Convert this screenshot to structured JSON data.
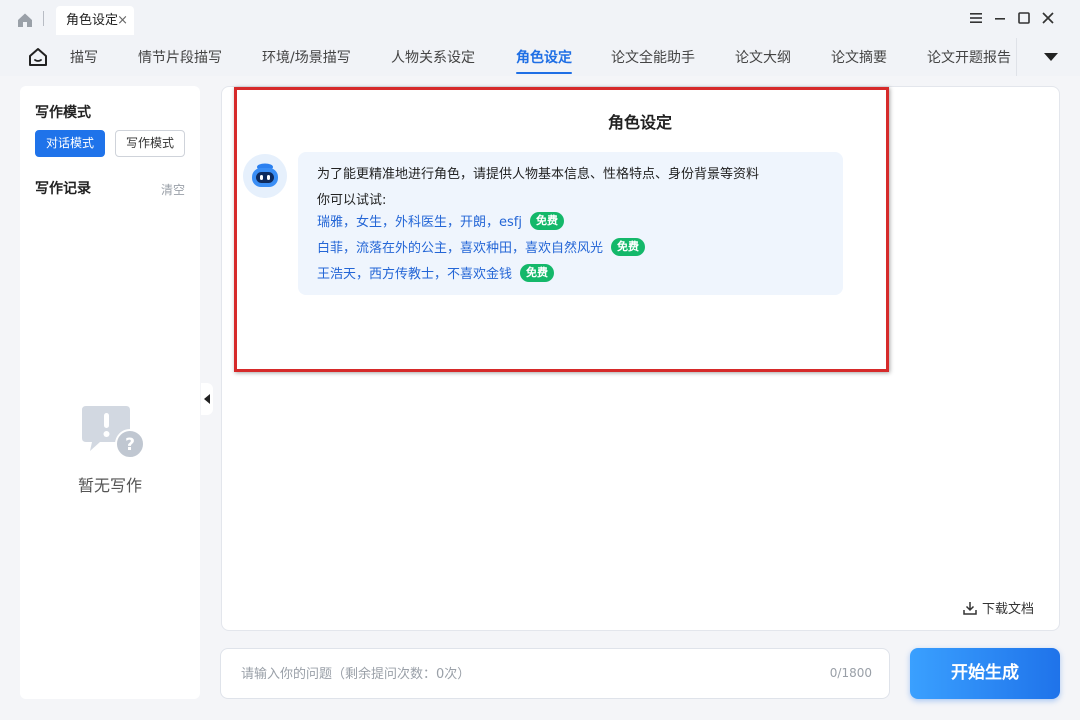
{
  "titlebar": {
    "tab_label": "角色设定",
    "close_symbol": "×"
  },
  "nav": {
    "items": [
      "描写",
      "情节片段描写",
      "环境/场景描写",
      "人物关系设定",
      "角色设定",
      "论文全能助手",
      "论文大纲",
      "论文摘要",
      "论文开题报告"
    ],
    "active_index": 4
  },
  "sidebar": {
    "mode_title": "写作模式",
    "modes": [
      "对话模式",
      "写作模式"
    ],
    "active_mode": 0,
    "records_title": "写作记录",
    "clear_label": "清空",
    "empty_text": "暂无写作"
  },
  "main": {
    "title": "角色设定",
    "intro": "为了能更精准地进行角色，请提供人物基本信息、性格特点、身份背景等资料",
    "try_label": "你可以试试:",
    "suggestions": [
      "瑞雅，女生，外科医生，开朗，esfj",
      "白菲，流落在外的公主，喜欢种田，喜欢自然风光",
      "王浩天，西方传教士，不喜欢金钱"
    ],
    "free_badge": "免费",
    "download_label": "下载文档"
  },
  "input": {
    "placeholder": "请输入你的问题（剩余提问次数：0次）",
    "counter": "0/1800",
    "generate_label": "开始生成"
  },
  "colors": {
    "accent": "#1f73ea",
    "free_badge": "#14b86a",
    "highlight_border": "#d62a2a",
    "link": "#2466d6"
  },
  "icons": [
    "home-icon",
    "menu-icon",
    "minimize-icon",
    "maximize-icon",
    "close-icon",
    "nav-home-icon",
    "more-dropdown-icon",
    "empty-chat-icon",
    "bot-avatar-icon",
    "download-icon",
    "collapse-sidebar-icon"
  ]
}
